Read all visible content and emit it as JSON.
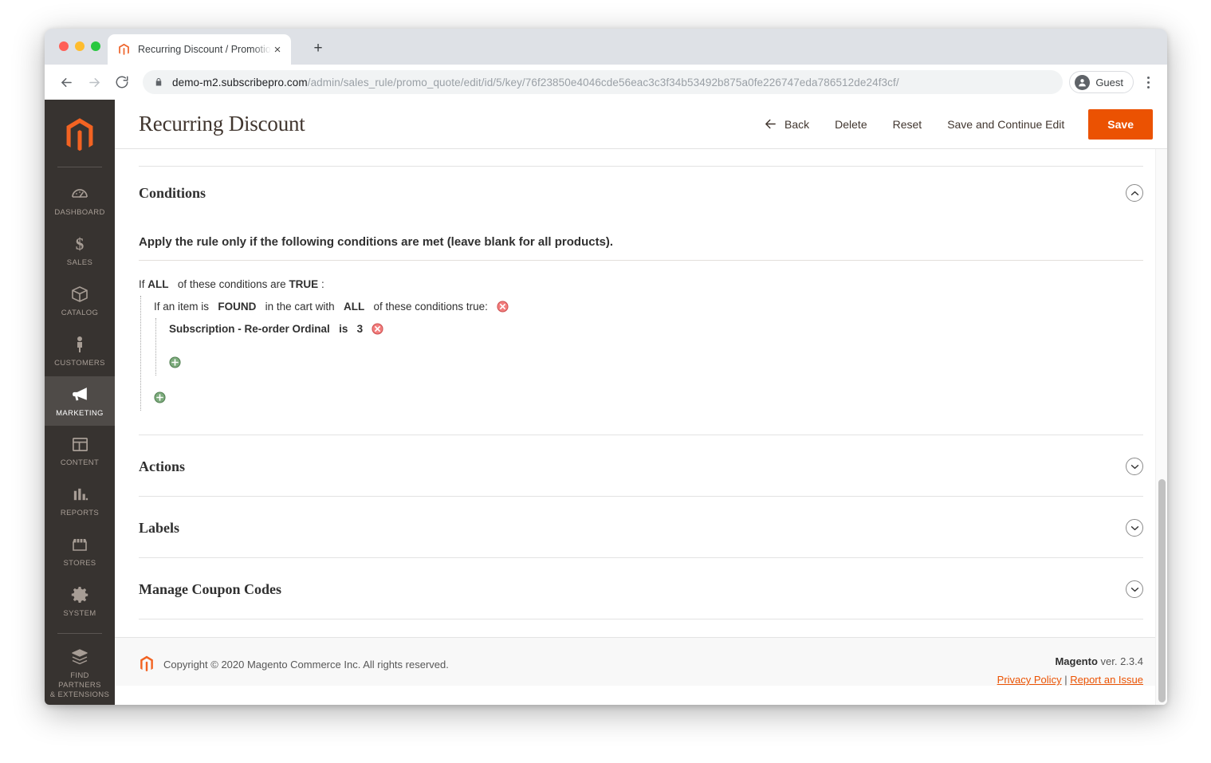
{
  "browser": {
    "tab": {
      "title": "Recurring Discount / Promotion",
      "favicon": "magento-icon",
      "close": "×"
    },
    "new_tab": "+",
    "nav": {
      "back": "←",
      "forward": "→",
      "reload": "⟳"
    },
    "url": {
      "domain": "demo-m2.subscribepro.com",
      "path": "/admin/sales_rule/promo_quote/edit/id/5/key/76f23850e4046cde56eac3c3f34b53492b875a0fe226747eda786512de24f3cf/",
      "lock": "lock-icon"
    },
    "profile": {
      "label": "Guest",
      "avatar": "person-icon"
    },
    "menu": "kebab-menu-icon"
  },
  "sidebar": {
    "logo": "magento-logo",
    "items": [
      {
        "label": "DASHBOARD",
        "icon": "gauge-icon",
        "active": false
      },
      {
        "label": "SALES",
        "icon": "dollar-icon",
        "active": false
      },
      {
        "label": "CATALOG",
        "icon": "box-icon",
        "active": false
      },
      {
        "label": "CUSTOMERS",
        "icon": "person-icon",
        "active": false
      },
      {
        "label": "MARKETING",
        "icon": "megaphone-icon",
        "active": true
      },
      {
        "label": "CONTENT",
        "icon": "layout-icon",
        "active": false
      },
      {
        "label": "REPORTS",
        "icon": "bar-chart-icon",
        "active": false
      },
      {
        "label": "STORES",
        "icon": "storefront-icon",
        "active": false
      },
      {
        "label": "SYSTEM",
        "icon": "gear-icon",
        "active": false
      },
      {
        "label": "FIND PARTNERS\n& EXTENSIONS",
        "icon": "extension-box-icon",
        "active": false
      }
    ]
  },
  "header": {
    "title": "Recurring Discount",
    "buttons": {
      "back": "Back",
      "back_icon": "arrow-left-icon",
      "delete": "Delete",
      "reset": "Reset",
      "save_continue": "Save and Continue Edit",
      "save": "Save"
    },
    "accent_color": "#eb5202"
  },
  "sections": {
    "conditions": {
      "title": "Conditions",
      "expanded": true,
      "toggle_icon": "chevron-up-icon",
      "legend": "Apply the rule only if the following conditions are met (leave blank for all products).",
      "rule": {
        "root": {
          "prefix": "If",
          "aggregator": "ALL",
          "middle": "of these conditions are",
          "value": "TRUE",
          "suffix": ":"
        },
        "item": {
          "prefix": "If an item is",
          "found": "FOUND",
          "middle": "in the cart with",
          "aggregator": "ALL",
          "suffix": "of these conditions true:",
          "remove_icon": "remove-condition-icon"
        },
        "leaf": {
          "attribute": "Subscription - Re-order Ordinal",
          "operator": "is",
          "value": "3",
          "remove_icon": "remove-condition-icon"
        },
        "add_inner_icon": "add-condition-icon",
        "add_outer_icon": "add-condition-icon"
      }
    },
    "collapsed": [
      {
        "title": "Actions",
        "toggle_icon": "chevron-down-icon"
      },
      {
        "title": "Labels",
        "toggle_icon": "chevron-down-icon"
      },
      {
        "title": "Manage Coupon Codes",
        "toggle_icon": "chevron-down-icon"
      }
    ]
  },
  "footer": {
    "logo": "magento-icon",
    "copyright": "Copyright © 2020 Magento Commerce Inc. All rights reserved.",
    "brand": "Magento",
    "version": "ver. 2.3.4",
    "privacy_policy": "Privacy Policy",
    "separator": "|",
    "report_issue": "Report an Issue"
  }
}
